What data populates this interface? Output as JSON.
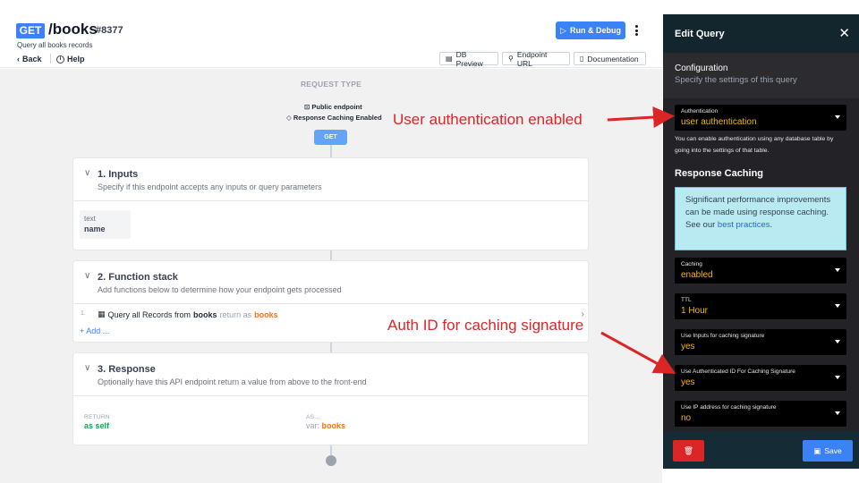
{
  "header": {
    "verb": "GET",
    "path": "/books",
    "id": "#8377",
    "description": "Query all books records",
    "back_label": "Back",
    "help_label": "Help",
    "run_label": "Run & Debug",
    "db_preview_label": "DB Preview",
    "endpoint_url_label": "Endpoint URL",
    "documentation_label": "Documentation"
  },
  "canvas": {
    "request_type_label": "REQUEST TYPE",
    "public_flag": "Public endpoint",
    "cache_flag": "Response Caching Enabled",
    "verb_pill": "GET",
    "inputs": {
      "title": "1. Inputs",
      "subtitle": "Specify if this endpoint accepts any inputs or query parameters",
      "input_type": "text",
      "input_name": "name"
    },
    "function_stack": {
      "title": "2. Function stack",
      "subtitle": "Add functions below to determine how your endpoint gets processed",
      "row_number": "1.",
      "row_prefix": "Query all Records from",
      "row_table": "books",
      "row_mid": "return as",
      "row_var": "books",
      "add_label": "Add ..."
    },
    "response": {
      "title": "3. Response",
      "subtitle": "Optionally have this API endpoint return a value from above to the front-end",
      "return_label": "RETURN",
      "return_value": "as self",
      "as_label": "AS...",
      "as_prefix": "var:",
      "as_value": "books"
    }
  },
  "annotations": {
    "auth": "User authentication enabled",
    "caching": "Auth ID for caching signature"
  },
  "panel": {
    "title": "Edit Query",
    "config_title": "Configuration",
    "config_subtitle": "Specify the settings of this query",
    "authentication": {
      "label": "Authentication",
      "value": "user authentication"
    },
    "auth_note": "You can enable authentication using any database table by going into the settings of that table.",
    "response_caching_title": "Response Caching",
    "info_text": "Significant performance improvements can be made using response caching. See our",
    "info_link": "best practices",
    "info_end": ".",
    "caching": {
      "label": "Caching",
      "value": "enabled"
    },
    "ttl": {
      "label": "TTL",
      "value": "1 Hour"
    },
    "use_inputs": {
      "label": "Use Inputs for caching signature",
      "value": "yes"
    },
    "use_auth_id": {
      "label": "Use Authenticated ID For Caching Signature",
      "value": "yes"
    },
    "use_ip": {
      "label": "Use IP address for caching signature",
      "value": "no"
    },
    "save_label": "Save"
  },
  "colors": {
    "accent": "#3b82f6",
    "annotation": "#dc2626",
    "value_highlight": "#f5b800",
    "var_orange": "#f97316"
  }
}
